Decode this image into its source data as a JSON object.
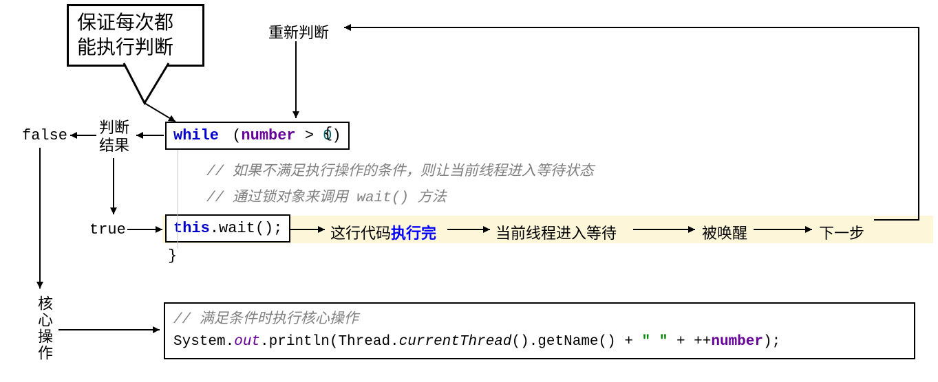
{
  "bubble": {
    "line1": "保证每次都",
    "line2": "能执行判断"
  },
  "top_label": "重新判断",
  "left": {
    "false": "false",
    "judge_result_l1": "判断",
    "judge_result_l2": "结果",
    "true": "true",
    "core_op": "核心操作"
  },
  "while_box": {
    "kw": "while",
    "lp": "(",
    "var": "number",
    "op": " > ",
    "num": "0",
    "rp": ")"
  },
  "open_brace": " {",
  "comment1": "// 如果不满足执行操作的条件，则让当前线程进入等待状态",
  "comment2": "// 通过锁对象来调用 wait() 方法",
  "wait_box": {
    "this": "this",
    "call": ".wait();"
  },
  "flow": {
    "exec_done_pre": "这行代码",
    "exec_done_hl": "执行完",
    "enter_wait": "当前线程进入等待",
    "woken": "被唤醒",
    "next": "下一步"
  },
  "close_brace": "}",
  "core_box": {
    "comment": "// 满足条件时执行核心操作",
    "sys": "System.",
    "out": "out",
    "println": ".println(Thread.",
    "ct": "currentThread",
    "rest1": "().getName() + ",
    "str": "\" \"",
    "plus": " + ++",
    "var": "number",
    "end": ");"
  }
}
